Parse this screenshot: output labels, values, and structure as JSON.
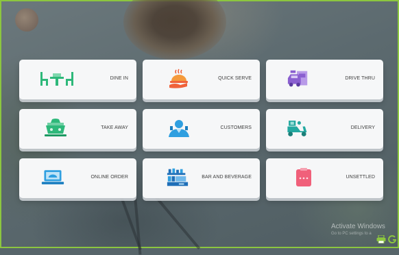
{
  "tiles": [
    {
      "label": "DINE IN",
      "icon": "dine-in-table-icon",
      "color": "#2eb87a"
    },
    {
      "label": "QUICK SERVE",
      "icon": "serving-dish-icon",
      "color": "#f0623a"
    },
    {
      "label": "DRIVE THRU",
      "icon": "drive-thru-car-icon",
      "color": "#8a5fd0"
    },
    {
      "label": "TAKE AWAY",
      "icon": "takeaway-bag-icon",
      "color": "#2eb87a"
    },
    {
      "label": "CUSTOMERS",
      "icon": "customer-person-icon",
      "color": "#2f9fe0"
    },
    {
      "label": "DELIVERY",
      "icon": "delivery-scooter-icon",
      "color": "#23a8a0"
    },
    {
      "label": "ONLINE ORDER",
      "icon": "online-order-laptop-icon",
      "color": "#2f9fe0"
    },
    {
      "label": "BAR AND BEVERAGE",
      "icon": "bar-beverage-icon",
      "color": "#1f6fb8"
    },
    {
      "label": "UNSETTLED",
      "icon": "unsettled-clipboard-icon",
      "color": "#f0607a"
    }
  ],
  "watermark": {
    "title": "Activate Windows",
    "subtitle": "Go to PC settings to a"
  },
  "colors": {
    "frame_border": "#8cc63f",
    "card_bg": "#f6f7f8"
  }
}
